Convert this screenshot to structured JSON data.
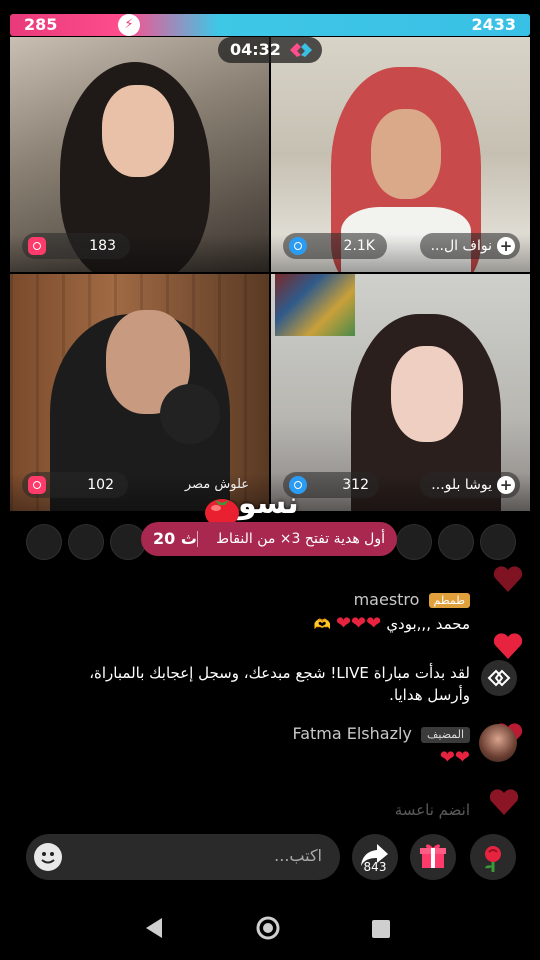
{
  "battle": {
    "left_score": "285",
    "right_score": "2433",
    "timer": "04:32"
  },
  "tiles": [
    {
      "id": "top-left",
      "count": "183",
      "name": ""
    },
    {
      "id": "top-right",
      "count": "2.1K",
      "name": "نواف ال..."
    },
    {
      "id": "bottom-left",
      "count": "102",
      "name": "علوش مصر"
    },
    {
      "id": "bottom-right",
      "count": "312",
      "name": "يوشا بلو..."
    }
  ],
  "stream_title": "نسوم",
  "gift_banner": {
    "countdown": "20 ث",
    "text": "أول هدية تفتح 3× من النقاط"
  },
  "chat": [
    {
      "user": "maestro",
      "badge": "طمطم",
      "message": "محمد ,,,بودي"
    },
    {
      "system": "لقد بدأت مباراة LIVE! شجع مبدعك، وسجل إعجابك بالمباراة، وأرسل هدايا."
    },
    {
      "user": "Fatma Elshazly",
      "badge": "المضيف",
      "message": ""
    },
    {
      "user": "",
      "message": "انضم ناعسة"
    }
  ],
  "input": {
    "placeholder": "اكتب..."
  },
  "share_count": "843",
  "icons": {
    "share": "share-icon",
    "gift": "gift-icon",
    "rose": "rose-icon",
    "emoji": "emoji-icon",
    "back": "back-nav-icon",
    "home": "home-nav-icon",
    "recents": "recents-nav-icon"
  },
  "colors": {
    "accent": "#e83a7a",
    "blue": "#39c0e5",
    "banner": "#a8284f"
  }
}
